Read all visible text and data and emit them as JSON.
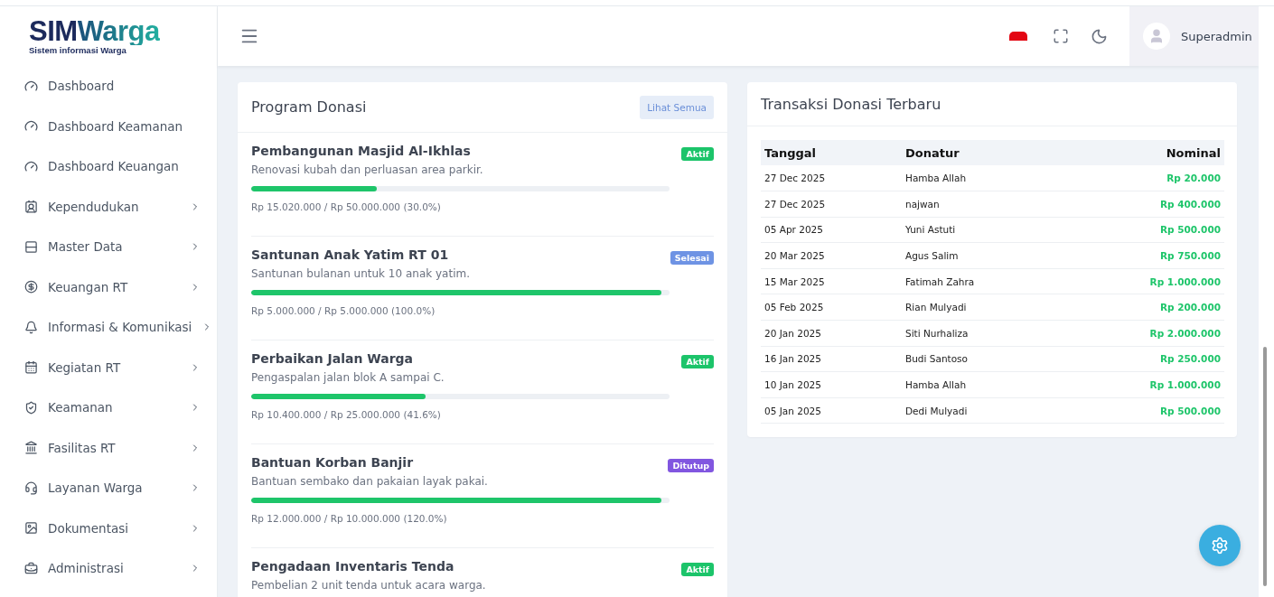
{
  "logo": {
    "part_1": "SIM",
    "part_2": "Warga",
    "tagline": "Sistem informasi Warga"
  },
  "sidebar": {
    "items": [
      {
        "label": "Dashboard",
        "has_children": false
      },
      {
        "label": "Dashboard Keamanan",
        "has_children": false
      },
      {
        "label": "Dashboard Keuangan",
        "has_children": false
      },
      {
        "label": "Kependudukan",
        "has_children": true
      },
      {
        "label": "Master Data",
        "has_children": true
      },
      {
        "label": "Keuangan RT",
        "has_children": true
      },
      {
        "label": "Informasi & Komunikasi",
        "has_children": true
      },
      {
        "label": "Kegiatan RT",
        "has_children": true
      },
      {
        "label": "Keamanan",
        "has_children": true
      },
      {
        "label": "Fasilitas RT",
        "has_children": true
      },
      {
        "label": "Layanan Warga",
        "has_children": true
      },
      {
        "label": "Dokumentasi",
        "has_children": true
      },
      {
        "label": "Administrasi",
        "has_children": true
      }
    ]
  },
  "header": {
    "user": "Superadmin"
  },
  "program_card": {
    "title": "Program Donasi",
    "button": "Lihat Semua",
    "programs": [
      {
        "title": "Pembangunan Masjid Al-Ikhlas",
        "description": "Renovasi kubah dan perluasan area parkir.",
        "status": {
          "label": "Aktif",
          "kind": "active"
        },
        "level": 0.3,
        "amount": "Rp 15.020.000 / Rp 50.000.000 (30.0%)"
      },
      {
        "title": "Santunan Anak Yatim RT 01",
        "description": "Santunan bulanan untuk 10 anak yatim.",
        "status": {
          "label": "Selesai",
          "kind": "done"
        },
        "level": 1,
        "amount": "Rp 5.000.000 / Rp 5.000.000 (100.0%)"
      },
      {
        "title": "Perbaikan Jalan Warga",
        "description": "Pengaspalan jalan blok A sampai C.",
        "status": {
          "label": "Aktif",
          "kind": "active"
        },
        "level": 0.416,
        "amount": "Rp 10.400.000 / Rp 25.000.000 (41.6%)"
      },
      {
        "title": "Bantuan Korban Banjir",
        "description": "Bantuan sembako dan pakaian layak pakai.",
        "status": {
          "label": "Ditutup",
          "kind": "closed"
        },
        "level": 1,
        "amount": "Rp 12.000.000 / Rp 10.000.000 (120.0%)"
      },
      {
        "title": "Pengadaan Inventaris Tenda",
        "description": "Pembelian 2 unit tenda untuk acara warga.",
        "status": {
          "label": "Aktif",
          "kind": "active"
        }
      }
    ]
  },
  "transactions_card": {
    "title": "Transaksi Donasi Terbaru",
    "columns": [
      "Tanggal",
      "Donatur",
      "Nominal"
    ],
    "rows": [
      [
        "27 Dec 2025",
        "Hamba Allah",
        "Rp 20.000"
      ],
      [
        "27 Dec 2025",
        "najwan",
        "Rp 400.000"
      ],
      [
        "05 Apr 2025",
        "Yuni Astuti",
        "Rp 500.000"
      ],
      [
        "20 Mar 2025",
        "Agus Salim",
        "Rp 750.000"
      ],
      [
        "15 Mar 2025",
        "Fatimah Zahra",
        "Rp 1.000.000"
      ],
      [
        "05 Feb 2025",
        "Rian Mulyadi",
        "Rp 200.000"
      ],
      [
        "20 Jan 2025",
        "Siti Nurhaliza",
        "Rp 2.000.000"
      ],
      [
        "16 Jan 2025",
        "Budi Santoso",
        "Rp 250.000"
      ],
      [
        "10 Jan 2025",
        "Hamba Allah",
        "Rp 1.000.000"
      ],
      [
        "05 Jan 2025",
        "Dedi Mulyadi",
        "Rp 500.000"
      ]
    ]
  }
}
